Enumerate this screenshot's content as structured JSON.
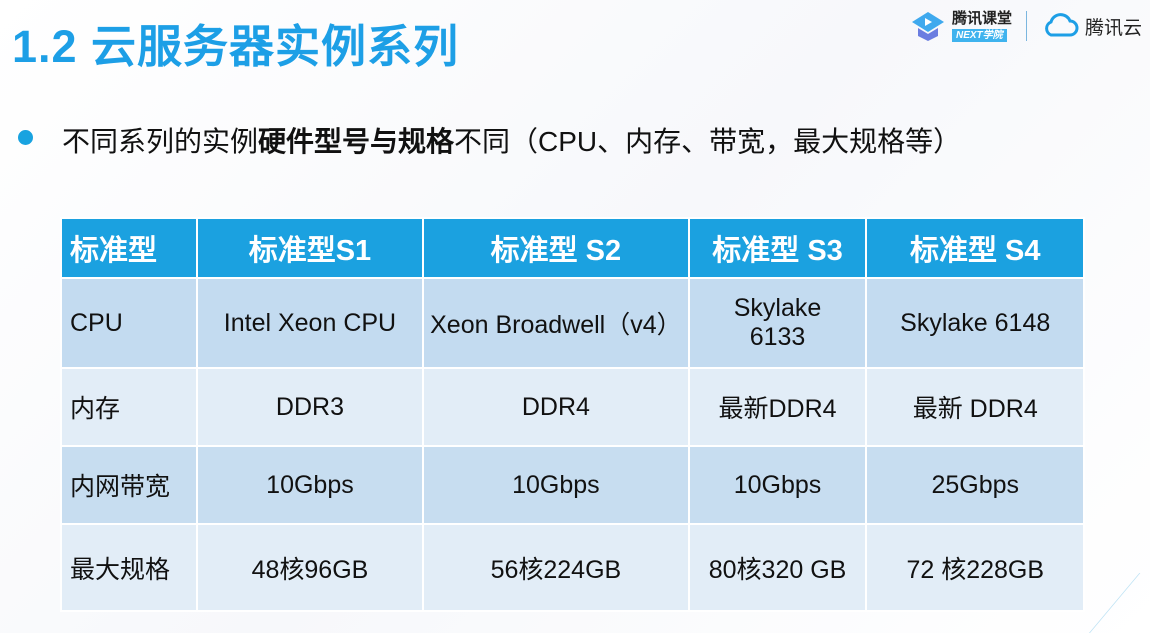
{
  "title": "1.2 云服务器实例系列",
  "logo": {
    "ketang": "腾讯课堂",
    "next": "NEXT学院",
    "cloud": "腾讯云"
  },
  "bullet": {
    "pre": "不同系列的实例",
    "bold": "硬件型号与规格",
    "post": "不同（CPU、内存、带宽，最大规格等）"
  },
  "colors": {
    "accent": "#1ba1e0",
    "row_dark": "#c3dbf0",
    "row_light": "#e2edf7"
  },
  "table": {
    "headers": [
      "标准型",
      "标准型S1",
      "标准型 S2",
      "标准型 S3",
      "标准型 S4"
    ],
    "rows": [
      [
        "CPU",
        "Intel Xeon CPU",
        "Xeon Broadwell（v4）",
        "Skylake 6133",
        "Skylake 6148"
      ],
      [
        "内存",
        "DDR3",
        "DDR4",
        "最新DDR4",
        "最新 DDR4"
      ],
      [
        "内网带宽",
        "10Gbps",
        "10Gbps",
        "10Gbps",
        "25Gbps"
      ],
      [
        "最大规格",
        "48核96GB",
        "56核224GB",
        "80核320 GB",
        "72 核228GB"
      ]
    ]
  }
}
